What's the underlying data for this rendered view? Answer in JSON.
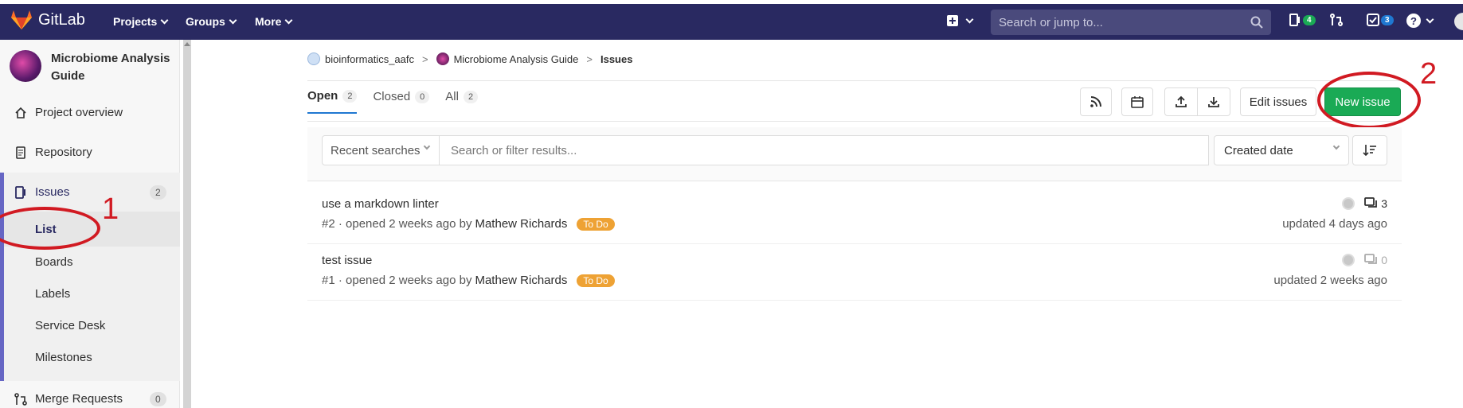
{
  "topbar": {
    "brand": "GitLab",
    "nav": [
      "Projects",
      "Groups",
      "More"
    ],
    "search_placeholder": "Search or jump to...",
    "badges": {
      "todos_count": "4",
      "issues_count": "3"
    },
    "colors": {
      "bg": "#292961",
      "green_badge": "#1aaa55",
      "blue_badge": "#1f78d1"
    }
  },
  "sidebar": {
    "project_name": "Microbiome Analysis Guide",
    "items": {
      "overview": "Project overview",
      "repository": "Repository",
      "issues": "Issues",
      "issues_count": "2",
      "merge_requests": "Merge Requests",
      "mr_count": "0"
    },
    "issues_sub": [
      "List",
      "Boards",
      "Labels",
      "Service Desk",
      "Milestones"
    ]
  },
  "breadcrumb": {
    "group": "bioinformatics_aafc",
    "project": "Microbiome Analysis Guide",
    "current": "Issues"
  },
  "tabs": [
    {
      "label": "Open",
      "count": "2"
    },
    {
      "label": "Closed",
      "count": "0"
    },
    {
      "label": "All",
      "count": "2"
    }
  ],
  "toolbar": {
    "edit_issues": "Edit issues",
    "new_issue": "New issue"
  },
  "filter": {
    "recent_searches": "Recent searches",
    "placeholder": "Search or filter results...",
    "sort": "Created date"
  },
  "issues": [
    {
      "title": "use a markdown linter",
      "ref": "#2 · opened 2 weeks ago by",
      "author": "Mathew Richards",
      "label": "To Do",
      "comments": "3",
      "updated": "updated 4 days ago"
    },
    {
      "title": "test issue",
      "ref": "#1 · opened 2 weeks ago by",
      "author": "Mathew Richards",
      "label": "To Do",
      "comments": "0",
      "updated": "updated 2 weeks ago"
    }
  ],
  "annotations": {
    "one": "1",
    "two": "2"
  }
}
